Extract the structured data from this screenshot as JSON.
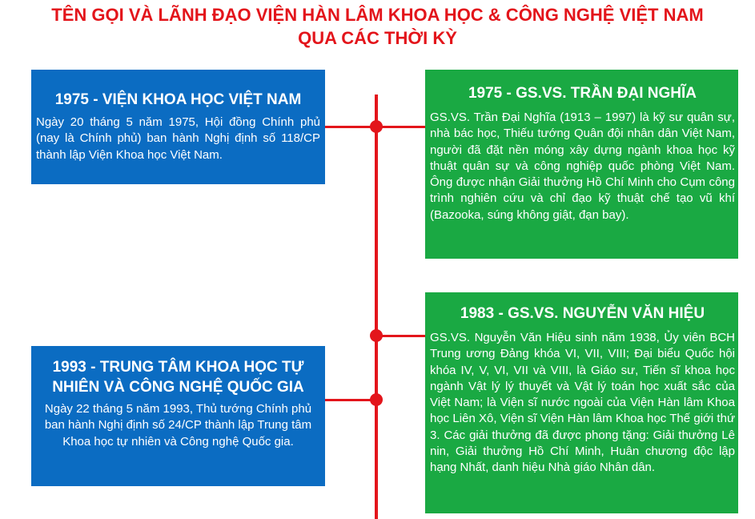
{
  "title": {
    "line1": "TÊN GỌI VÀ LÃNH ĐẠO VIỆN HÀN LÂM KHOA HỌC & CÔNG NGHỆ VIỆT NAM",
    "line2": "QUA CÁC THỜI KỲ"
  },
  "left": [
    {
      "heading": "1975 - VIỆN KHOA HỌC VIỆT NAM",
      "body": "Ngày 20 tháng 5 năm 1975, Hội đồng Chính phủ (nay là Chính phủ) ban hành Nghị định số 118/CP thành lập Viện Khoa học Việt Nam."
    },
    {
      "heading_line1": "1993 - TRUNG TÂM KHOA HỌC TỰ",
      "heading_line2": "NHIÊN VÀ CÔNG NGHỆ QUỐC GIA",
      "body": "Ngày 22 tháng 5 năm 1993, Thủ tướng Chính phủ ban hành Nghị định số 24/CP thành lập Trung tâm Khoa học tự nhiên và Công nghệ Quốc gia."
    }
  ],
  "right": [
    {
      "heading": "1975 - GS.VS. TRẦN ĐẠI NGHĨA",
      "body": "GS.VS. Trần Đại Nghĩa (1913 – 1997) là kỹ sư quân sự, nhà bác học, Thiếu tướng Quân đội nhân dân Việt Nam, người đã đặt nền móng xây dựng ngành khoa học kỹ thuật quân sự và công nghiệp quốc phòng Việt Nam. Ông được nhận Giải thưởng Hồ Chí Minh cho Cụm công trình nghiên cứu và chỉ đạo kỹ thuật chế tạo vũ khí (Bazooka, súng không giật, đạn bay)."
    },
    {
      "heading": "1983 - GS.VS. NGUYỄN VĂN HIỆU",
      "body": "GS.VS. Nguyễn Văn Hiệu sinh năm 1938, Ủy viên BCH Trung ương Đảng khóa VI, VII, VIII; Đại biểu Quốc hội khóa IV, V, VI, VII và VIII, là Giáo sư, Tiến sĩ khoa học ngành Vật lý lý thuyết và Vật lý toán học xuất sắc của Việt Nam; là Viện sĩ nước ngoài của Viện Hàn lâm Khoa học Liên Xô, Viện sĩ Viện Hàn lâm Khoa học Thế giới thứ 3. Các giải thưởng đã được phong tặng: Giải thưởng Lê nin, Giải thưởng Hồ Chí Minh, Huân chương độc lập hạng Nhất, danh hiệu Nhà giáo Nhân dân."
    }
  ],
  "colors": {
    "accent": "#e3151b",
    "blue": "#0b6cc2",
    "green": "#1aa943"
  }
}
